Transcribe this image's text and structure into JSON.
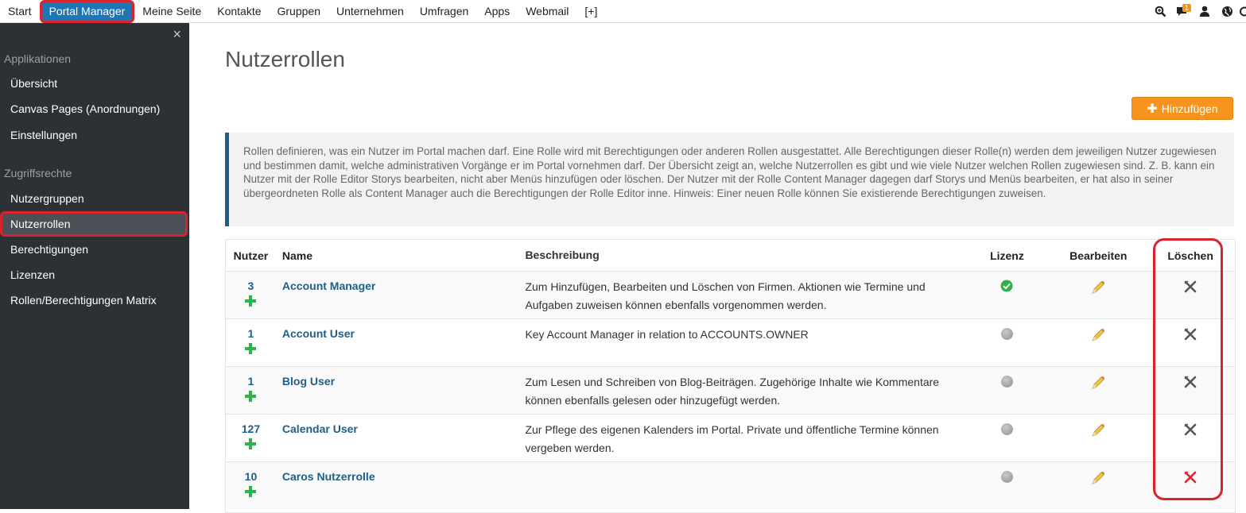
{
  "topnav": {
    "items": [
      "Start",
      "Portal Manager",
      "Meine Seite",
      "Kontakte",
      "Gruppen",
      "Unternehmen",
      "Umfragen",
      "Apps",
      "Webmail",
      "[+]"
    ],
    "notification_count": "1"
  },
  "sidebar": {
    "close_glyph": "×",
    "section_apps": "Applikationen",
    "apps_items": [
      "Übersicht",
      "Canvas Pages (Anordnungen)",
      "Einstellungen"
    ],
    "section_access": "Zugriffsrechte",
    "access_items": [
      "Nutzergruppen",
      "Nutzerrollen",
      "Berechtigungen",
      "Lizenzen",
      "Rollen/Berechtigungen Matrix"
    ]
  },
  "main": {
    "title": "Nutzerrollen",
    "add_button": "Hinzufügen",
    "info_text": "Rollen definieren, was ein Nutzer im Portal machen darf. Eine Rolle wird mit Berechtigungen oder anderen Rollen ausgestattet. Alle Berechtigungen dieser Rolle(n) werden dem jeweiligen Nutzer zugewiesen und bestimmen damit, welche administrativen Vorgänge er im Portal vornehmen darf. Der Übersicht zeigt an, welche Nutzerrollen es gibt und wie viele Nutzer welchen Rollen zugewiesen sind. Z. B. kann ein Nutzer mit der Rolle Editor Storys bearbeiten, nicht aber Menüs hinzufügen oder löschen. Der Nutzer mit der Rolle Content Manager dagegen darf Storys und Menüs bearbeiten, er hat also in seiner übergeordneten Rolle als Content Manager auch die Berechtigungen der Rolle Editor inne. Hinweis: Einer neuen Rolle können Sie existierende Berechtigungen zuweisen."
  },
  "table": {
    "headers": {
      "users": "Nutzer",
      "name": "Name",
      "desc": "Beschreibung",
      "license": "Lizenz",
      "edit": "Bearbeiten",
      "delete": "Löschen"
    },
    "rows": [
      {
        "users": "3",
        "name": "Account Manager",
        "desc": "Zum Hinzufügen, Bearbeiten und Löschen von Firmen. Aktionen wie Termine und Aufgaben zuweisen können ebenfalls vorgenommen werden.",
        "license": "green",
        "delete_color": "grey"
      },
      {
        "users": "1",
        "name": "Account User",
        "desc": "Key Account Manager in relation to ACCOUNTS.OWNER",
        "license": "grey",
        "delete_color": "grey"
      },
      {
        "users": "1",
        "name": "Blog User",
        "desc": "Zum Lesen und Schreiben von Blog-Beiträgen. Zugehörige Inhalte wie Kommentare können ebenfalls gelesen oder hinzugefügt werden.",
        "license": "grey",
        "delete_color": "grey"
      },
      {
        "users": "127",
        "name": "Calendar User",
        "desc": "Zur Pflege des eigenen Kalenders im Portal. Private und öffentliche Termine können vergeben werden.",
        "license": "grey",
        "delete_color": "grey"
      },
      {
        "users": "10",
        "name": "Caros Nutzerrolle",
        "desc": "",
        "license": "grey",
        "delete_color": "red"
      }
    ]
  },
  "colors": {
    "accent": "#1f76b4",
    "button": "#f7941d",
    "highlight": "#d9232d",
    "sidebar_bg": "#2c3136"
  }
}
